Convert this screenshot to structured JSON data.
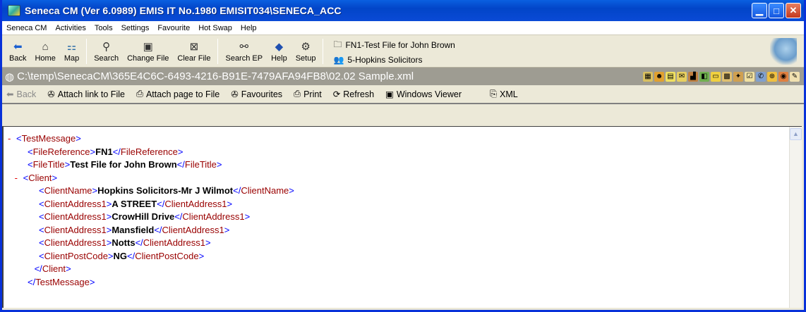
{
  "window": {
    "title": "Seneca CM  (Ver 6.0989)  EMIS IT No.1980  EMISIT034\\SENECA_ACC"
  },
  "menu": [
    "Seneca CM",
    "Activities",
    "Tools",
    "Settings",
    "Favourite",
    "Hot Swap",
    "Help"
  ],
  "toolbar": {
    "buttons": [
      {
        "label": "Back",
        "icon": "back-arrow-icon"
      },
      {
        "label": "Home",
        "icon": "home-icon"
      },
      {
        "label": "Map",
        "icon": "map-icon"
      },
      {
        "label": "Search",
        "icon": "search-icon"
      },
      {
        "label": "Change File",
        "icon": "change-file-icon"
      },
      {
        "label": "Clear File",
        "icon": "clear-file-icon"
      },
      {
        "label": "Search EP",
        "icon": "search-ep-icon"
      },
      {
        "label": "Help",
        "icon": "help-icon"
      },
      {
        "label": "Setup",
        "icon": "setup-icon"
      }
    ],
    "file_line": "FN1-Test File for John Brown",
    "client_line": "5-Hopkins Solicitors"
  },
  "pathbar": {
    "path": "C:\\temp\\SenecaCM\\365E4C6C-6493-4216-B91E-7479AFA94FB8\\02.02 Sample.xml"
  },
  "nav": {
    "back": "Back",
    "attach_link": "Attach link to File",
    "attach_page": "Attach page to File",
    "favourites": "Favourites",
    "print": "Print",
    "refresh": "Refresh",
    "windows_viewer": "Windows Viewer",
    "xml": "XML"
  },
  "xml": {
    "lines": [
      {
        "indent": 0,
        "dash": "-",
        "open": "TestMessage",
        "value": null,
        "close": null
      },
      {
        "indent": 1,
        "dash": "",
        "open": "FileReference",
        "value": "FN1",
        "close": "FileReference"
      },
      {
        "indent": 1,
        "dash": "",
        "open": "FileTitle",
        "value": "Test File for John Brown",
        "close": "FileTitle"
      },
      {
        "indent": 0.6,
        "dash": "-",
        "open": "Client",
        "value": null,
        "close": null
      },
      {
        "indent": 2,
        "dash": "",
        "open": "ClientName",
        "value": "Hopkins Solicitors-Mr J Wilmot",
        "close": "ClientName"
      },
      {
        "indent": 2,
        "dash": "",
        "open": "ClientAddress1",
        "value": "A STREET",
        "close": "ClientAddress1"
      },
      {
        "indent": 2,
        "dash": "",
        "open": "ClientAddress1",
        "value": "CrowHill Drive",
        "close": "ClientAddress1"
      },
      {
        "indent": 2,
        "dash": "",
        "open": "ClientAddress1",
        "value": "Mansfield",
        "close": "ClientAddress1"
      },
      {
        "indent": 2,
        "dash": "",
        "open": "ClientAddress1",
        "value": "Notts",
        "close": "ClientAddress1"
      },
      {
        "indent": 2,
        "dash": "",
        "open": "ClientPostCode",
        "value": "NG",
        "close": "ClientPostCode"
      },
      {
        "indent": 1.6,
        "dash": "",
        "open": null,
        "value": null,
        "close": "Client"
      },
      {
        "indent": 1,
        "dash": "",
        "open": null,
        "value": null,
        "close": "TestMessage"
      }
    ]
  }
}
